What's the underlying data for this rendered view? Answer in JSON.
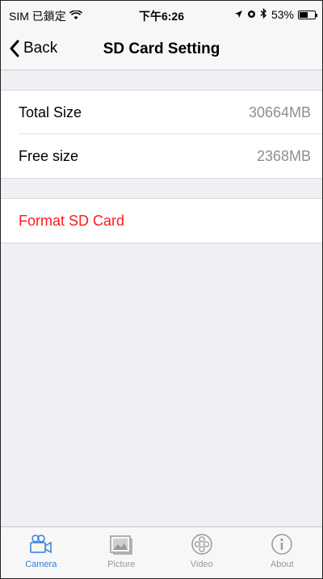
{
  "status_bar": {
    "carrier": "SIM 已鎖定",
    "time": "下午6:26",
    "battery_percent": "53%",
    "battery_level": 0.53
  },
  "nav": {
    "back_label": "Back",
    "title": "SD Card Setting"
  },
  "storage": {
    "total_label": "Total Size",
    "total_value": "30664MB",
    "free_label": "Free size",
    "free_value": "2368MB"
  },
  "actions": {
    "format_label": "Format SD Card"
  },
  "tabs": [
    {
      "label": "Camera",
      "icon": "camera-icon",
      "active": true
    },
    {
      "label": "Picture",
      "icon": "picture-icon",
      "active": false
    },
    {
      "label": "Video",
      "icon": "video-reel-icon",
      "active": false
    },
    {
      "label": "About",
      "icon": "info-icon",
      "active": false
    }
  ],
  "colors": {
    "accent": "#2f7fe0",
    "danger": "#ff1a1a",
    "background": "#efeff4"
  }
}
